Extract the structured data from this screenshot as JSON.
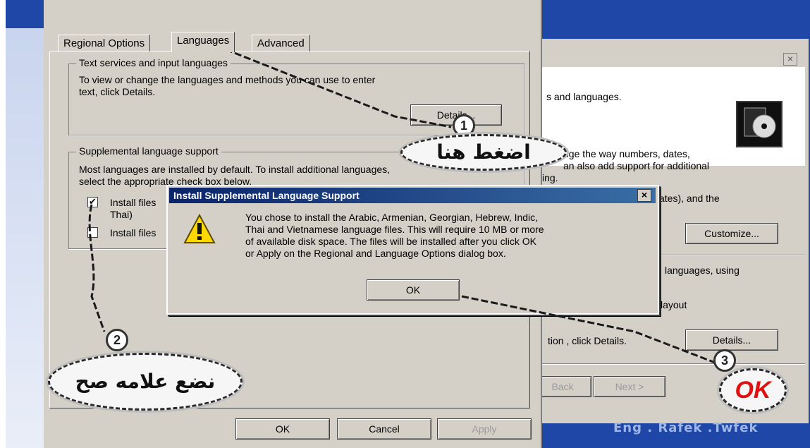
{
  "main_window": {
    "tabs": [
      "Regional Options",
      "Languages",
      "Advanced"
    ],
    "active_tab_index": 1,
    "text_services": {
      "group_label": "Text services and input languages",
      "description": [
        "To view or change the languages and methods you can use to enter",
        "text, click Details."
      ],
      "details_button": "Details..."
    },
    "supplemental": {
      "group_label": "Supplemental language support",
      "description": [
        "Most languages are installed by default. To install additional languages,",
        "select the appropriate check box below."
      ],
      "checkbox1_label": "Install files",
      "checkbox1_label_cont": "Thai)",
      "checkbox1_checked": true,
      "checkbox2_label": "Install files",
      "checkbox2_checked": false
    },
    "footer": {
      "ok": "OK",
      "cancel": "Cancel",
      "apply": "Apply"
    }
  },
  "background_window": {
    "header_text": "s and languages.",
    "line1": "nge the way numbers, dates,",
    "line2": "an also add support for additional",
    "line3": "ing.",
    "line4": "ates), and the",
    "customize_button": "Customize...",
    "line5": "languages, using",
    "line6": "layout",
    "line7": "tion , click Details.",
    "details_button": "Details...",
    "back_button": "Back",
    "next_button": "Next >"
  },
  "dialog": {
    "title": "Install Supplemental Language Support",
    "close_glyph": "×",
    "message": [
      "You chose to install the Arabic, Armenian, Georgian, Hebrew, Indic,",
      "Thai and Vietnamese language files. This will require 10 MB or more",
      "of available disk space. The files will be installed after you click OK",
      "or Apply on the Regional and Language Options dialog box."
    ],
    "ok_button": "OK"
  },
  "annotations": {
    "step1_number": "1",
    "step1_text": "اضغط هنا",
    "step2_number": "2",
    "step2_text": "نضع علامه صح",
    "step3_number": "3",
    "step3_text": "OK"
  },
  "credit": "Eng . Rafek .Twfek",
  "colors": {
    "accent_blue": "#1f47a8",
    "title_bar": "#0a246a",
    "ok_red": "#e01010"
  }
}
